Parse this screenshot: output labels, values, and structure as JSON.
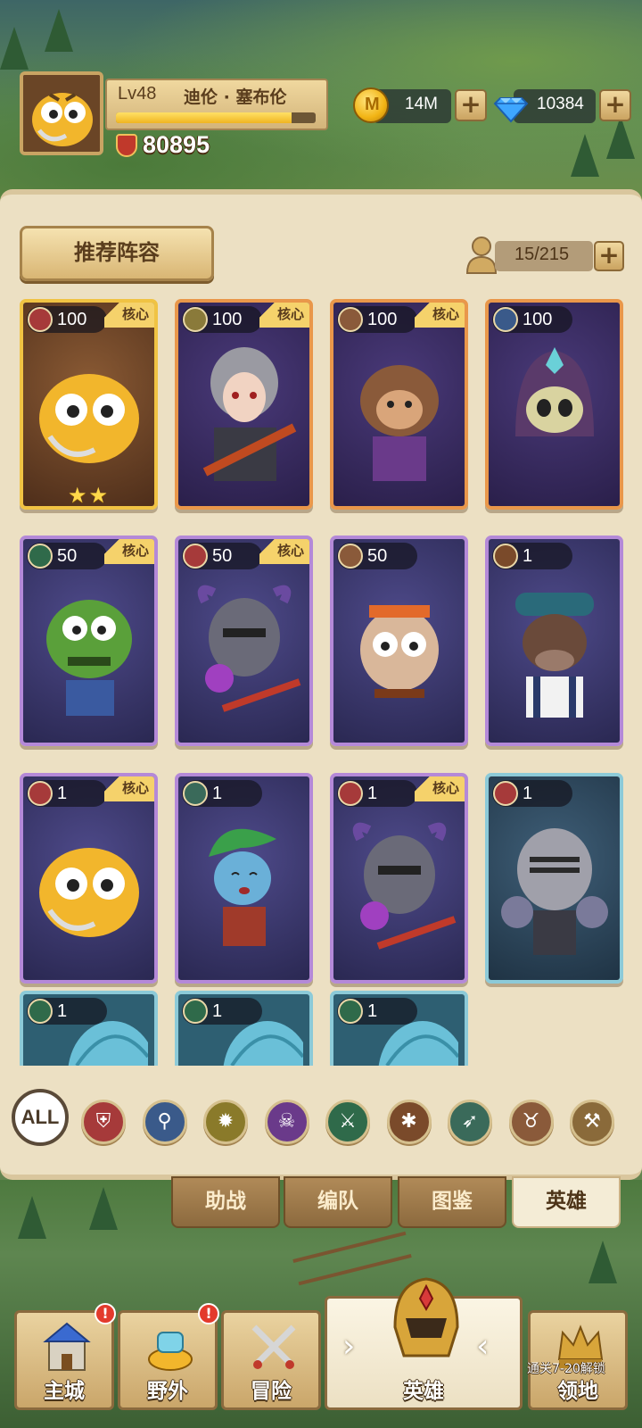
{
  "player": {
    "level_label": "Lv48",
    "name": "迪伦 · 塞布伦",
    "exp_fraction": 0.88,
    "power": "80895"
  },
  "resources": {
    "coins": "14M",
    "gems": "10384",
    "coin_icon": "coin-icon",
    "gem_icon": "diamond-icon"
  },
  "panel": {
    "recommend_label": "推荐阵容",
    "hero_count": "15/215"
  },
  "heroes": [
    {
      "level": "100",
      "core": "核心",
      "class_icon": "shield-icon",
      "frame": "gold",
      "stars": "★★",
      "subject": "yellow-toad"
    },
    {
      "level": "100",
      "core": "核心",
      "class_icon": "axe-icon",
      "frame": "orange",
      "subject": "silver-hair-warrior"
    },
    {
      "level": "100",
      "core": "核心",
      "class_icon": "bull-icon",
      "frame": "orange",
      "subject": "monkey-king"
    },
    {
      "level": "100",
      "core": "",
      "class_icon": "staff-icon",
      "frame": "orange",
      "subject": "hooded-mage"
    },
    {
      "level": "50",
      "core": "核心",
      "class_icon": "crossed-swords-icon",
      "frame": "purple",
      "subject": "green-orc"
    },
    {
      "level": "50",
      "core": "核心",
      "class_icon": "shield-icon",
      "frame": "purple",
      "subject": "horned-knight"
    },
    {
      "level": "50",
      "core": "",
      "class_icon": "bull-icon",
      "frame": "purple",
      "subject": "pig-warrior"
    },
    {
      "level": "1",
      "core": "",
      "class_icon": "paw-icon",
      "frame": "purple",
      "subject": "cow-farmer"
    },
    {
      "level": "1",
      "core": "核心",
      "class_icon": "shield-icon",
      "frame": "purple",
      "subject": "yellow-toad"
    },
    {
      "level": "1",
      "core": "",
      "class_icon": "bow-icon",
      "frame": "purple",
      "subject": "blue-elf"
    },
    {
      "level": "1",
      "core": "核心",
      "class_icon": "shield-icon",
      "frame": "purple",
      "subject": "horned-knight"
    },
    {
      "level": "1",
      "core": "",
      "class_icon": "shield-icon",
      "frame": "teal",
      "subject": "helmet-knight"
    }
  ],
  "partial_heroes": [
    {
      "level": "1",
      "class_icon": "crossed-swords-icon"
    },
    {
      "level": "1",
      "class_icon": "crossed-swords-icon"
    },
    {
      "level": "1",
      "class_icon": "crossed-swords-icon"
    }
  ],
  "filters": {
    "all_label": "ALL",
    "icons": [
      "shield-icon",
      "staff-icon",
      "sun-emblem-icon",
      "skull-icon",
      "crossed-swords-icon",
      "paw-icon",
      "bow-icon",
      "bull-icon",
      "hammer-icon"
    ]
  },
  "subtabs": {
    "support": "助战",
    "formation": "编队",
    "codex": "图鉴",
    "heroes": "英雄"
  },
  "nav": {
    "city": "主城",
    "wild": "野外",
    "adventure": "冒险",
    "hero": "英雄",
    "territory": "领地",
    "territory_unlock": "通关7-20解锁",
    "badge": "!"
  }
}
